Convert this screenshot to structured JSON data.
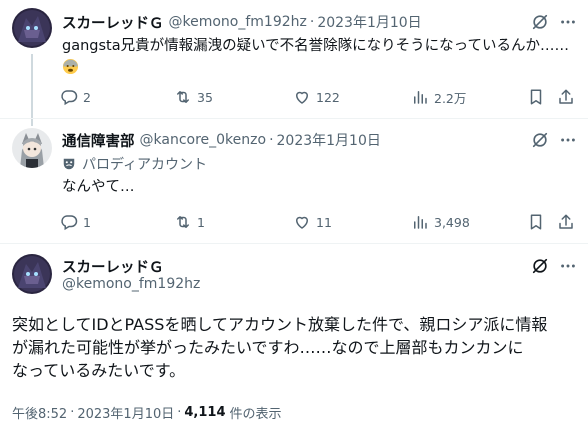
{
  "tweets": [
    {
      "name": "スカーレッドＧ",
      "handle": "@kemono_fm192hz",
      "date": "2023年1月10日",
      "text": "gangsta兄貴が情報漏洩の疑いで不名誉除隊になりそうになっているんか……",
      "emoji": "😨",
      "replies": "2",
      "retweets": "35",
      "likes": "122",
      "views": "2.2万"
    },
    {
      "name": "通信障害部",
      "handle": "@kancore_0kenzo",
      "date": "2023年1月10日",
      "label": "パロディアカウント",
      "text": "なんやて…",
      "replies": "1",
      "retweets": "1",
      "likes": "11",
      "views": "3,498"
    }
  ],
  "main": {
    "name": "スカーレッドＧ",
    "handle": "@kemono_fm192hz",
    "text_lines": [
      "突如としてIDとPASSを晒してアカウント放棄した件で、親ロシア派に情報",
      "が漏れた可能性が挙がったみたいですわ……なので上層部もカンカンに",
      "なっているみたいです。"
    ],
    "time": "午後8:52",
    "date": "2023年1月10日",
    "view_count": "4,114",
    "view_label": "件の表示"
  },
  "icons": {
    "grok": "grok-icon",
    "more": "more-icon",
    "reply": "reply-icon",
    "retweet": "retweet-icon",
    "like": "like-icon",
    "views": "views-icon",
    "bookmark": "bookmark-icon",
    "share": "share-icon",
    "parody": "theater-mask-icon"
  },
  "colors": {
    "text": "#0f1419",
    "secondary": "#536471",
    "border": "#eff3f4",
    "thread_line": "#cfd9de"
  }
}
